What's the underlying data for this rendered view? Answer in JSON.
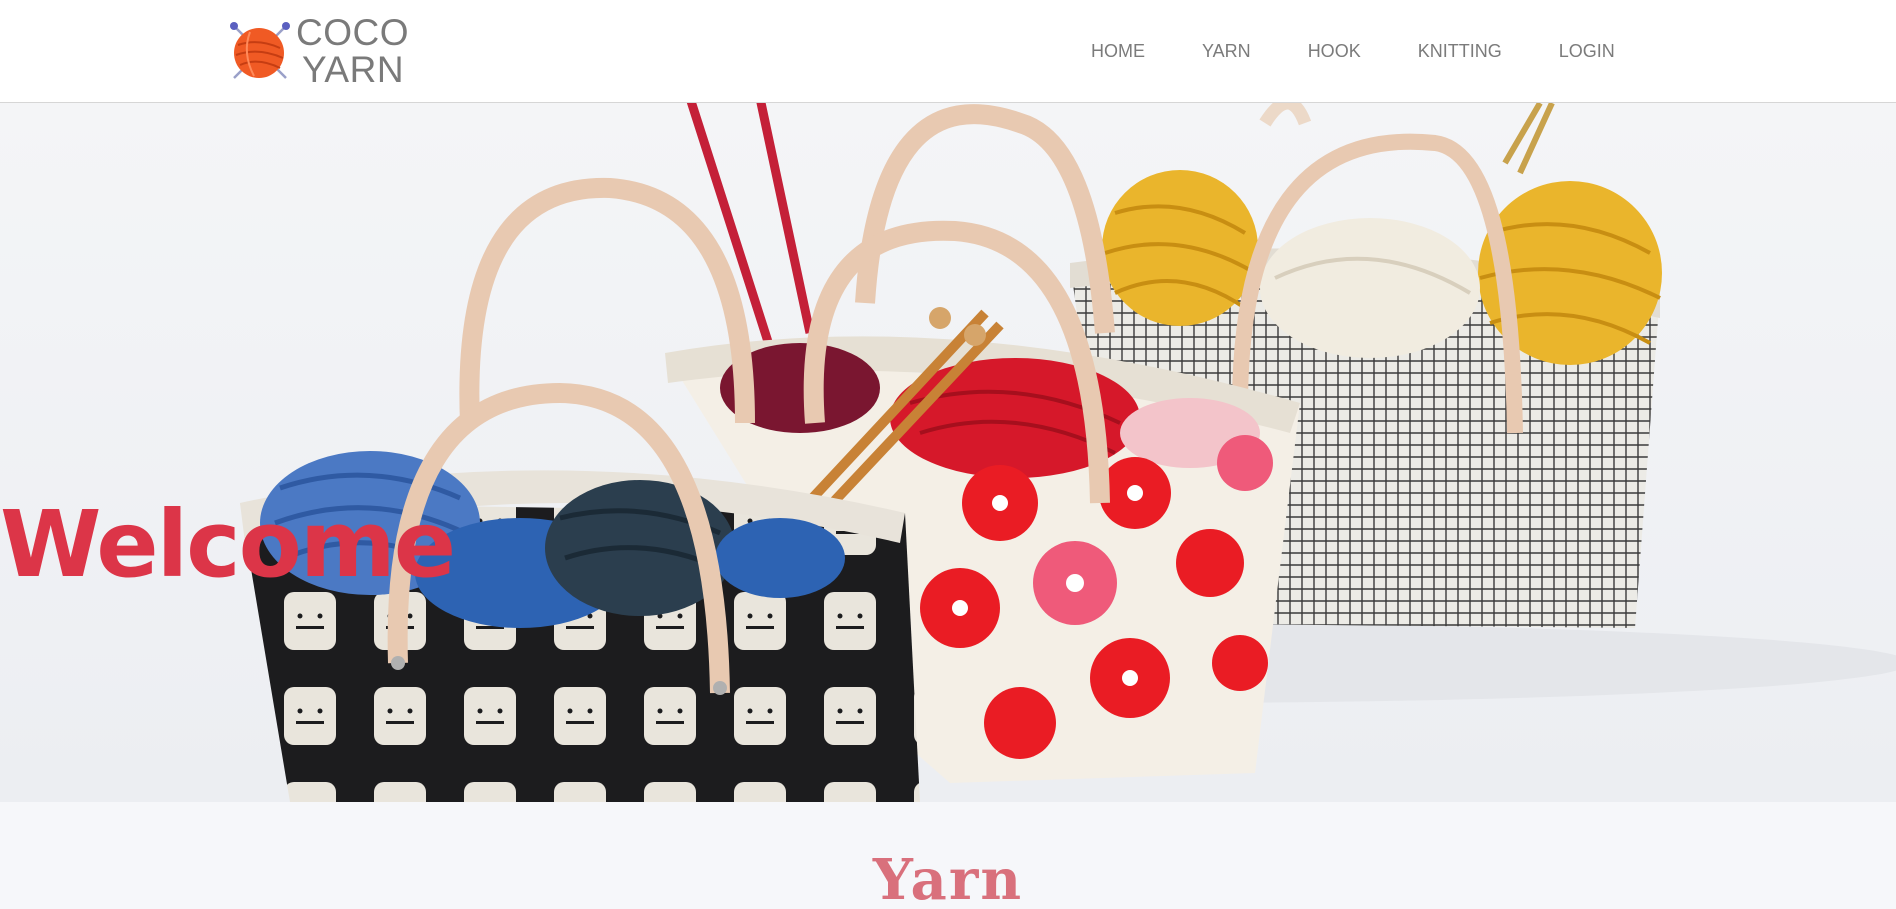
{
  "brand": {
    "line1": "COCO",
    "line2": "YARN",
    "logo_icon": "yarn-ball-icon"
  },
  "nav": {
    "items": [
      "HOME",
      "YARN",
      "HOOK",
      "KNITTING",
      "LOGIN"
    ]
  },
  "hero": {
    "heading": "Welcome",
    "image": "knitting-bags-with-yarn-photo"
  },
  "section": {
    "title": "Yarn"
  },
  "colors": {
    "accent": "#dc3548",
    "section_title": "#d9707c",
    "nav_text": "#7b7b7b",
    "logo_ball": "#f05a24"
  }
}
